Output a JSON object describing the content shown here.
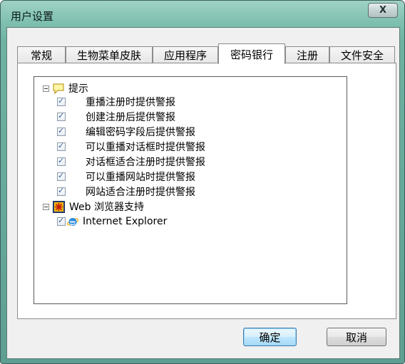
{
  "window": {
    "title": "用户设置",
    "close_label": "X"
  },
  "tabs": [
    {
      "label": "常规"
    },
    {
      "label": "生物菜单皮肤"
    },
    {
      "label": "应用程序"
    },
    {
      "label": "密码银行",
      "active": true
    },
    {
      "label": "注册"
    },
    {
      "label": "文件安全"
    }
  ],
  "tree": {
    "tips_group": {
      "label": "提示",
      "items": [
        {
          "label": "重播注册时提供警报",
          "checked": true
        },
        {
          "label": "创建注册后提供警报",
          "checked": true
        },
        {
          "label": "编辑密码字段后提供警报",
          "checked": true
        },
        {
          "label": "可以重播对话框时提供警报",
          "checked": true
        },
        {
          "label": "对话框适合注册时提供警报",
          "checked": true
        },
        {
          "label": "可以重播网站时提供警报",
          "checked": true
        },
        {
          "label": "网站适合注册时提供警报",
          "checked": true
        }
      ]
    },
    "browser_group": {
      "label": "Web 浏览器支持",
      "items": [
        {
          "label": "Internet Explorer",
          "checked": true
        }
      ]
    }
  },
  "buttons": {
    "ok": "确定",
    "cancel": "取消"
  },
  "colors": {
    "title_bar": "#7fc0b0",
    "default_button": "#bee6fd",
    "check": "#2f5e9e"
  }
}
